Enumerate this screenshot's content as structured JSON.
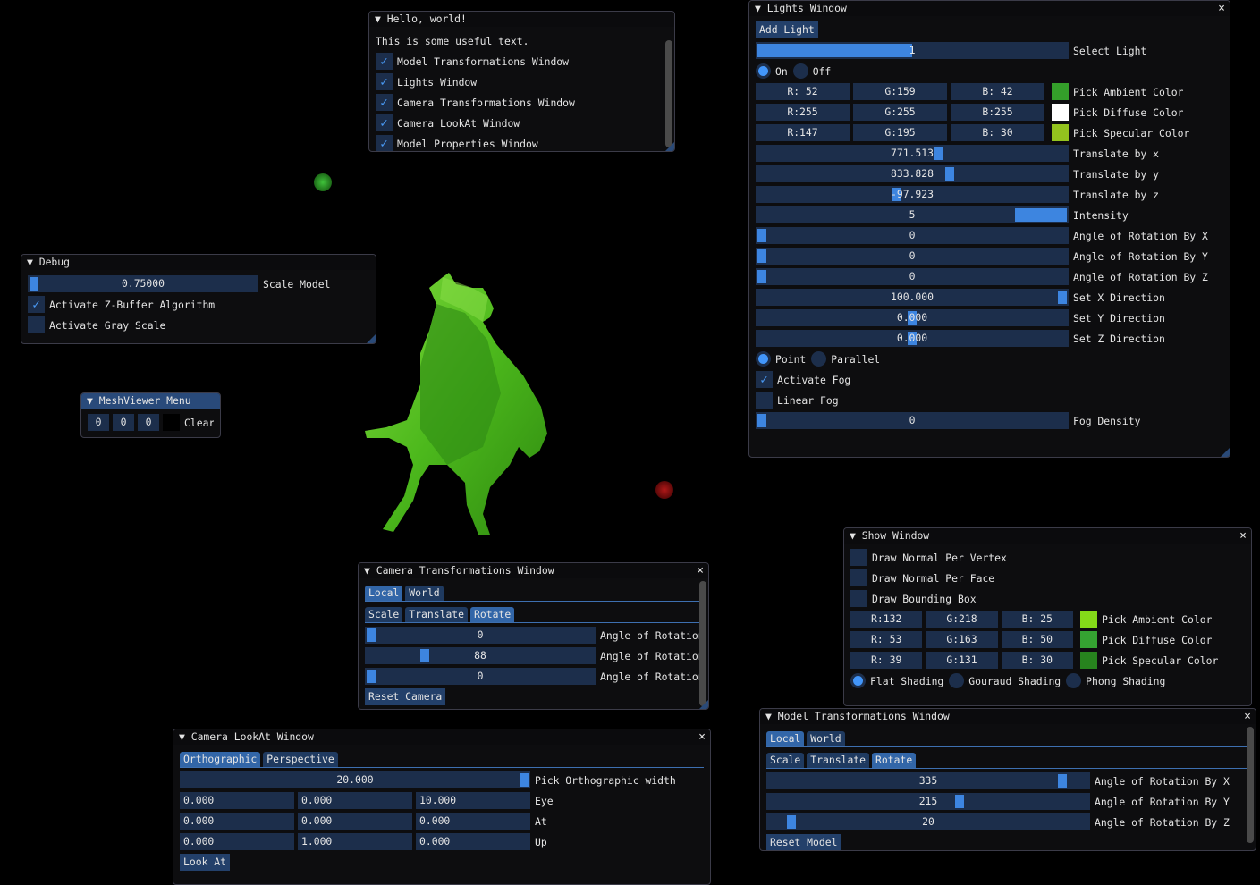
{
  "colors": {
    "frame": "#1c2e4b",
    "grab": "#3d85e0",
    "check": "#4296fa",
    "title_active": "#294a7a",
    "light_green": "#2f9a2a",
    "light_red": "#8a1010",
    "model": "#4cc21c"
  },
  "windows": {
    "hello": {
      "title": "Hello, world!",
      "rows": [
        {
          "type": "text",
          "text": "This is some useful text."
        },
        {
          "type": "checkbox",
          "label": "Model Transformations Window",
          "checked": true
        },
        {
          "type": "checkbox",
          "label": "Lights Window",
          "checked": true
        },
        {
          "type": "checkbox",
          "label": "Camera Transformations Window",
          "checked": true
        },
        {
          "type": "checkbox",
          "label": "Camera LookAt Window",
          "checked": true
        },
        {
          "type": "checkbox",
          "label": "Model Properties Window",
          "checked": true
        }
      ]
    },
    "debug": {
      "title": "Debug",
      "rows": [
        {
          "type": "slider",
          "value": "0.75000",
          "fraction": 0,
          "label": "Scale Model"
        },
        {
          "type": "checkbox",
          "label": "Activate Z-Buffer Algorithm",
          "checked": true
        },
        {
          "type": "checkbox",
          "label": "Activate Gray Scale",
          "checked": false
        }
      ]
    },
    "meshviewer": {
      "title": "MeshViewer Menu",
      "rows": [
        {
          "type": "ints",
          "values": [
            "0",
            "0",
            "0"
          ],
          "color": "#000000",
          "label": "Clear"
        }
      ]
    },
    "lights": {
      "title": "Lights Window",
      "close": "×",
      "rows": [
        {
          "type": "button",
          "label": "Add Light"
        },
        {
          "type": "slider",
          "value": "1",
          "fraction": 0,
          "steps": 2,
          "label": "Select Light"
        },
        {
          "type": "radios",
          "options": [
            "On",
            "Off"
          ],
          "selected": 0
        },
        {
          "type": "rgb",
          "values": [
            "R: 52",
            "G:159",
            "B: 42"
          ],
          "color": "#349f2a",
          "label": "Pick Ambient Color"
        },
        {
          "type": "rgb",
          "values": [
            "R:255",
            "G:255",
            "B:255"
          ],
          "color": "#ffffff",
          "label": "Pick Diffuse Color"
        },
        {
          "type": "rgb",
          "values": [
            "R:147",
            "G:195",
            "B: 30"
          ],
          "color": "#93c31e",
          "label": "Pick Specular Color"
        },
        {
          "type": "slider",
          "value": "771.513",
          "fraction": 0.59,
          "label": "Translate by x"
        },
        {
          "type": "slider",
          "value": "833.828",
          "fraction": 0.625,
          "label": "Translate by y"
        },
        {
          "type": "slider",
          "value": "-97.923",
          "fraction": 0.45,
          "label": "Translate by z"
        },
        {
          "type": "slider",
          "value": "5",
          "fraction": 1,
          "steps": 6,
          "label": "Intensity"
        },
        {
          "type": "slider",
          "value": "0",
          "fraction": 0,
          "label": "Angle of Rotation By X"
        },
        {
          "type": "slider",
          "value": "0",
          "fraction": 0,
          "label": "Angle of Rotation By Y"
        },
        {
          "type": "slider",
          "value": "0",
          "fraction": 0,
          "label": "Angle of Rotation By Z"
        },
        {
          "type": "slider",
          "value": "100.000",
          "fraction": 1,
          "label": "Set X Direction"
        },
        {
          "type": "slider",
          "value": "0.000",
          "fraction": 0.5,
          "label": "Set Y Direction"
        },
        {
          "type": "slider",
          "value": "0.000",
          "fraction": 0.5,
          "label": "Set Z Direction"
        },
        {
          "type": "radios",
          "options": [
            "Point",
            "Parallel"
          ],
          "selected": 0
        },
        {
          "type": "checkbox",
          "label": "Activate Fog",
          "checked": true
        },
        {
          "type": "checkbox",
          "label": "Linear Fog",
          "checked": false
        },
        {
          "type": "slider",
          "value": "0",
          "fraction": 0,
          "label": "Fog Density"
        }
      ]
    },
    "camt": {
      "title": "Camera Transformations Window",
      "close": "×",
      "rows": [
        {
          "type": "tabs",
          "tabs": [
            "Local",
            "World"
          ],
          "active": 0
        },
        {
          "type": "tabs",
          "tabs": [
            "Scale",
            "Translate",
            "Rotate"
          ],
          "active": 2
        },
        {
          "type": "slider",
          "value": "0",
          "fraction": 0,
          "label": "Angle of Rotation By X"
        },
        {
          "type": "slider",
          "value": "88",
          "fraction": 0.245,
          "label": "Angle of Rotation By Y"
        },
        {
          "type": "slider",
          "value": "0",
          "fraction": 0,
          "label": "Angle of Rotation By Z"
        },
        {
          "type": "button",
          "label": "Reset Camera"
        }
      ]
    },
    "lookat": {
      "title": "Camera LookAt Window",
      "close": "×",
      "rows": [
        {
          "type": "tabs",
          "tabs": [
            "Orthographic",
            "Perspective"
          ],
          "active": 0
        },
        {
          "type": "slider",
          "value": "20.000",
          "fraction": 1,
          "label": "Pick Orthographic width"
        },
        {
          "type": "input3",
          "values": [
            "0.000",
            "0.000",
            "10.000"
          ],
          "label": "Eye"
        },
        {
          "type": "input3",
          "values": [
            "0.000",
            "0.000",
            "0.000"
          ],
          "label": "At"
        },
        {
          "type": "input3",
          "values": [
            "0.000",
            "1.000",
            "0.000"
          ],
          "label": "Up"
        },
        {
          "type": "button",
          "label": "Look At"
        }
      ]
    },
    "show": {
      "title": "Show Window",
      "close": "×",
      "rows": [
        {
          "type": "checkbox",
          "label": "Draw Normal Per Vertex",
          "checked": false
        },
        {
          "type": "checkbox",
          "label": "Draw Normal Per Face",
          "checked": false
        },
        {
          "type": "checkbox",
          "label": "Draw Bounding Box",
          "checked": false
        },
        {
          "type": "rgb",
          "values": [
            "R:132",
            "G:218",
            "B: 25"
          ],
          "color": "#84da19",
          "label": "Pick Ambient Color"
        },
        {
          "type": "rgb",
          "values": [
            "R: 53",
            "G:163",
            "B: 50"
          ],
          "color": "#35a332",
          "label": "Pick Diffuse Color"
        },
        {
          "type": "rgb",
          "values": [
            "R: 39",
            "G:131",
            "B: 30"
          ],
          "color": "#27831e",
          "label": "Pick Specular Color"
        },
        {
          "type": "radios",
          "options": [
            "Flat Shading",
            "Gouraud Shading",
            "Phong Shading"
          ],
          "selected": 0
        }
      ]
    },
    "modelt": {
      "title": "Model Transformations Window",
      "close": "×",
      "rows": [
        {
          "type": "tabs",
          "tabs": [
            "Local",
            "World"
          ],
          "active": 0
        },
        {
          "type": "tabs",
          "tabs": [
            "Scale",
            "Translate",
            "Rotate"
          ],
          "active": 2
        },
        {
          "type": "slider",
          "value": "335",
          "fraction": 0.93,
          "label": "Angle of Rotation By X"
        },
        {
          "type": "slider",
          "value": "215",
          "fraction": 0.6,
          "label": "Angle of Rotation By Y"
        },
        {
          "type": "slider",
          "value": "20",
          "fraction": 0.06,
          "label": "Angle of Rotation By Z"
        },
        {
          "type": "button",
          "label": "Reset Model"
        }
      ]
    }
  }
}
